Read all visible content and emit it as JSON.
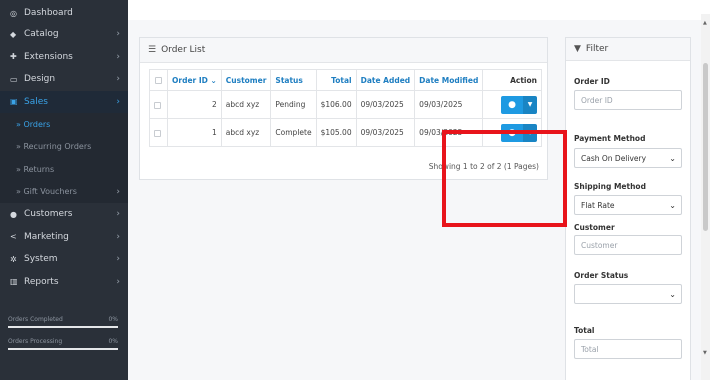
{
  "sidebar": {
    "items": [
      {
        "icon": "dashboard-icon",
        "glyph": "◎",
        "label": "Dashboard",
        "arrow": ""
      },
      {
        "icon": "tag-icon",
        "glyph": "◆",
        "label": "Catalog",
        "arrow": "›"
      },
      {
        "icon": "puzzle-icon",
        "glyph": "✚",
        "label": "Extensions",
        "arrow": "›"
      },
      {
        "icon": "monitor-icon",
        "glyph": "▭",
        "label": "Design",
        "arrow": "›"
      },
      {
        "icon": "cart-icon",
        "glyph": "▣",
        "label": "Sales",
        "arrow": "›"
      }
    ],
    "sales_sub": [
      {
        "label": "» Orders"
      },
      {
        "label": "» Recurring Orders"
      },
      {
        "label": "» Returns"
      },
      {
        "label": "» Gift Vouchers",
        "arrow": "›"
      }
    ],
    "items2": [
      {
        "icon": "user-icon",
        "glyph": "●",
        "label": "Customers",
        "arrow": "›"
      },
      {
        "icon": "share-icon",
        "glyph": "<",
        "label": "Marketing",
        "arrow": "›"
      },
      {
        "icon": "gear-icon",
        "glyph": "✲",
        "label": "System",
        "arrow": "›"
      },
      {
        "icon": "bar-chart-icon",
        "glyph": "▥",
        "label": "Reports",
        "arrow": "›"
      }
    ],
    "stats": [
      {
        "label": "Orders Completed",
        "value": "0%",
        "progress": 0
      },
      {
        "label": "Orders Processing",
        "value": "0%",
        "progress": 0
      }
    ]
  },
  "order_list": {
    "title": "Order List",
    "columns": {
      "order_id": "Order ID ⌄",
      "customer": "Customer",
      "status": "Status",
      "total": "Total",
      "date_added": "Date Added",
      "date_modified": "Date Modified",
      "action": "Action"
    },
    "rows": [
      {
        "order_id": "2",
        "customer": "abcd xyz",
        "status": "Pending",
        "total": "$106.00",
        "date_added": "09/03/2025",
        "date_modified": "09/03/2025"
      },
      {
        "order_id": "1",
        "customer": "abcd xyz",
        "status": "Complete",
        "total": "$105.00",
        "date_added": "09/03/2025",
        "date_modified": "09/03/2025"
      }
    ],
    "showing": "Showing 1 to 2 of 2 (1 Pages)"
  },
  "filter": {
    "title": "Filter",
    "order_id_label": "Order ID",
    "order_id_placeholder": "Order ID",
    "payment_method_label": "Payment Method",
    "payment_method_value": "Cash On Delivery",
    "shipping_method_label": "Shipping Method",
    "shipping_method_value": "Flat Rate",
    "customer_label": "Customer",
    "customer_placeholder": "Customer",
    "order_status_label": "Order Status",
    "order_status_value": "",
    "total_label": "Total",
    "total_placeholder": "Total"
  },
  "colors": {
    "accent": "#1e9ae2",
    "highlight": "#e8141b",
    "sidebar_bg": "#2a3039"
  }
}
